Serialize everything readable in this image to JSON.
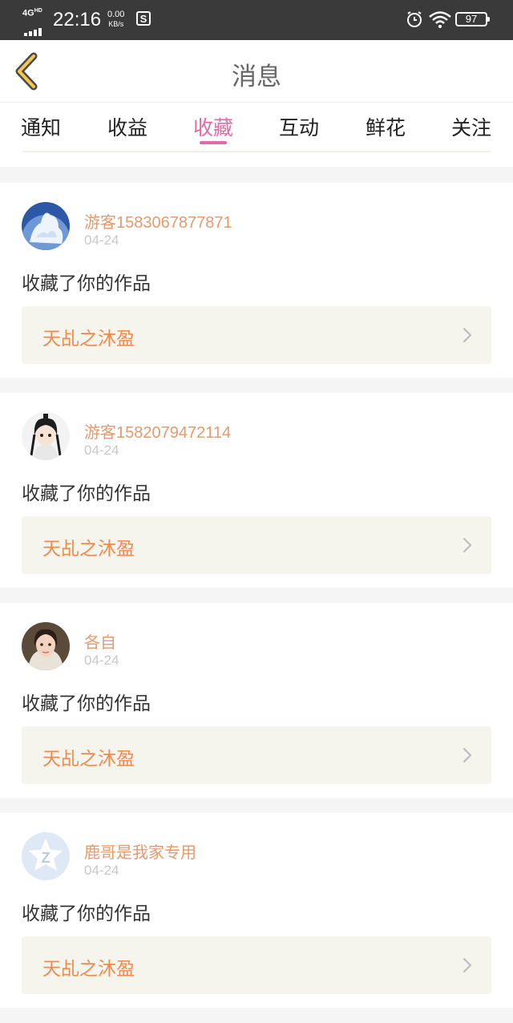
{
  "status_bar": {
    "network": "4G",
    "network_sup": "HD",
    "time": "22:16",
    "speed_value": "0.00",
    "speed_unit": "KB/s",
    "battery": "97",
    "icons": [
      "signal-icon",
      "s-notification-icon",
      "alarm-icon",
      "wifi-icon",
      "battery-icon"
    ]
  },
  "header": {
    "title": "消息",
    "back_icon": "chevron-left-icon"
  },
  "tabs": [
    {
      "label": "通知",
      "active": false
    },
    {
      "label": "收益",
      "active": false
    },
    {
      "label": "收藏",
      "active": true
    },
    {
      "label": "互动",
      "active": false
    },
    {
      "label": "鲜花",
      "active": false
    },
    {
      "label": "关注",
      "active": false
    }
  ],
  "accent_color": "#e26aa7",
  "username_color": "#e69a6c",
  "work_title_color": "#f08a4b",
  "messages": [
    {
      "user": "游客1583067877871",
      "date": "04-24",
      "action": "收藏了你的作品",
      "work": "天乩之沐盈",
      "avatar": "cloud-avatar"
    },
    {
      "user": "游客1582079472114",
      "date": "04-24",
      "action": "收藏了你的作品",
      "work": "天乩之沐盈",
      "avatar": "anime-avatar"
    },
    {
      "user": "各自",
      "date": "04-24",
      "action": "收藏了你的作品",
      "work": "天乩之沐盈",
      "avatar": "photo-avatar"
    },
    {
      "user": "鹿哥是我家专用",
      "date": "04-24",
      "action": "收藏了你的作品",
      "work": "天乩之沐盈",
      "avatar": "default-avatar"
    }
  ]
}
